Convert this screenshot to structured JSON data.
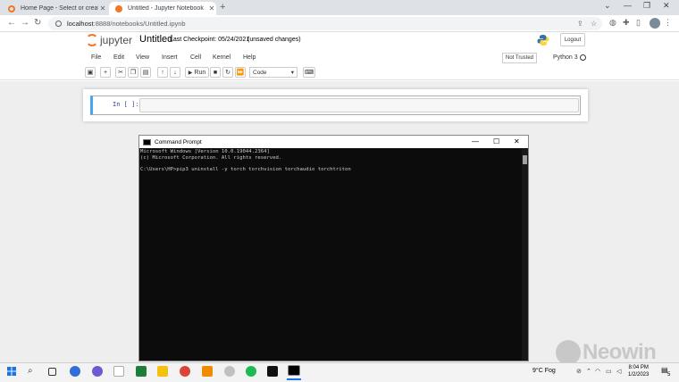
{
  "browser": {
    "tabs": [
      {
        "title": "Home Page - Select or create a n",
        "favicon_color": "#f37726"
      },
      {
        "title": "Untitled - Jupyter Notebook",
        "favicon_color": "#f37726"
      }
    ],
    "url_host": "localhost",
    "url_path": ":8888/notebooks/Untitled.ipynb"
  },
  "jupyter": {
    "brand": "jupyter",
    "notebook_title": "Untitled",
    "checkpoint": "Last Checkpoint: 05/24/2021",
    "unsaved": "(unsaved changes)",
    "logout": "Logout",
    "menu": [
      "File",
      "Edit",
      "View",
      "Insert",
      "Cell",
      "Kernel",
      "Help"
    ],
    "trusted": "Not Trusted",
    "kernel": "Python 3",
    "toolbar": {
      "run": "Run",
      "cell_type": "Code"
    },
    "cell_prompt": "In [ ]:"
  },
  "cmd": {
    "title": "Command Prompt",
    "lines": [
      "Microsoft Windows [Version 10.0.19044.2364]",
      "(c) Microsoft Corporation. All rights reserved.",
      "",
      "C:\\Users\\HP>pip3 uninstall -y torch torchvision torchaudio torchtriton"
    ]
  },
  "watermark": "Neowin",
  "taskbar": {
    "weather": "9°C Fog",
    "time": "8:04 PM",
    "date": "1/2/2023",
    "notification_count": "5"
  }
}
